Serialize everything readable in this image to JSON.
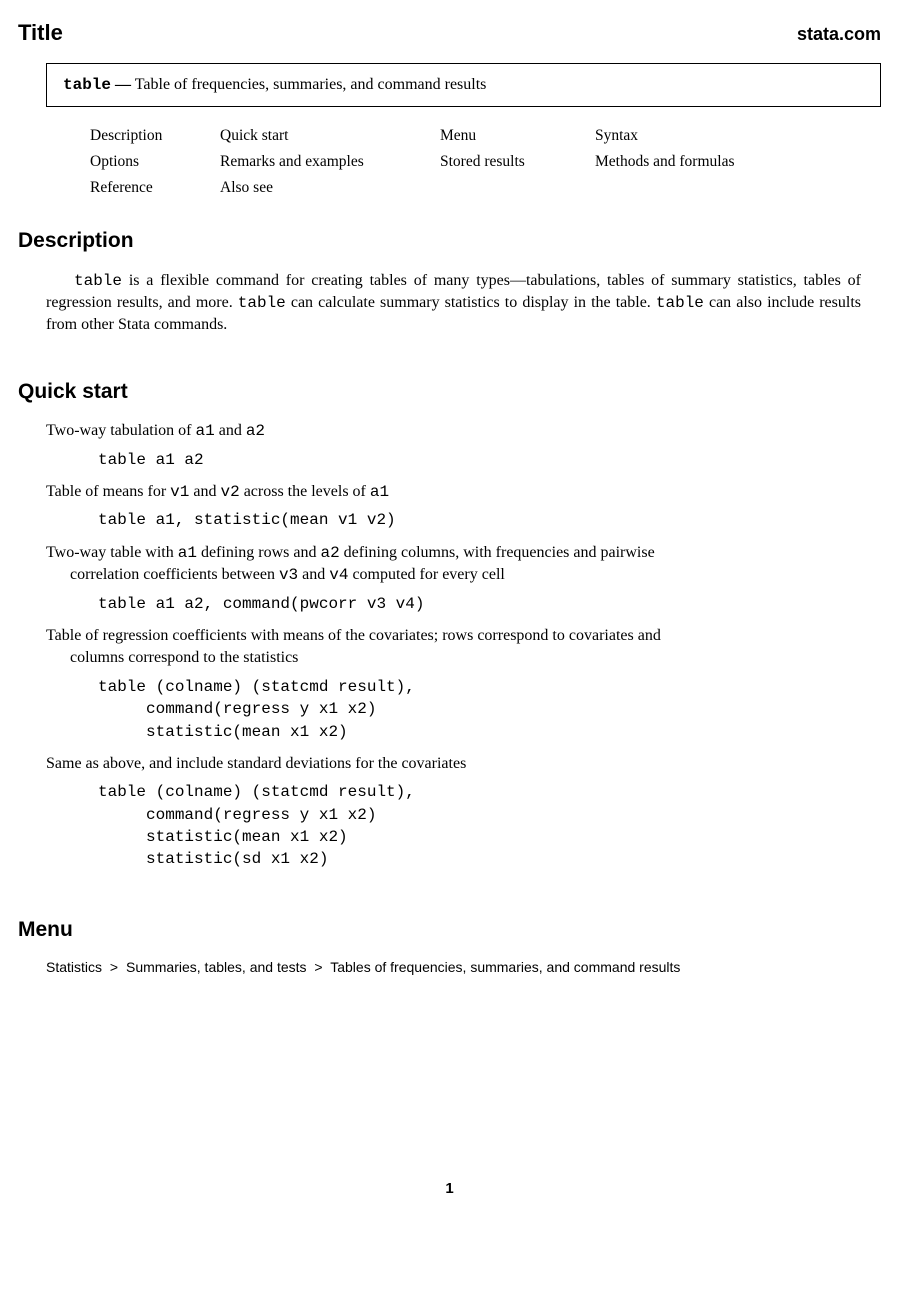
{
  "header": {
    "title": "Title",
    "site": "stata.com"
  },
  "titlebox": {
    "command": "table",
    "dash": "—",
    "text": "Table of frequencies, summaries, and command results"
  },
  "nav": {
    "r1c1": "Description",
    "r1c2": "Quick start",
    "r1c3": "Menu",
    "r1c4": "Syntax",
    "r2c1": "Options",
    "r2c2": "Remarks and examples",
    "r2c3": "Stored results",
    "r2c4": "Methods and formulas",
    "r3c1": "Reference",
    "r3c2": "Also see"
  },
  "sections": {
    "description_h": "Description",
    "quickstart_h": "Quick start",
    "menu_h": "Menu"
  },
  "description": {
    "p1_a": "table",
    "p1_b": " is a flexible command for creating tables of many types—tabulations, tables of summary statistics, tables of regression results, and more. ",
    "p1_c": "table",
    "p1_d": " can calculate summary statistics to display in the table. ",
    "p1_e": "table",
    "p1_f": " can also include results from other Stata commands."
  },
  "qs": {
    "i1_t1": "Two-way tabulation of ",
    "i1_a1": "a1",
    "i1_t2": " and ",
    "i1_a2": "a2",
    "i1_code": "table a1 a2",
    "i2_t1": "Table of means for ",
    "i2_v1": "v1",
    "i2_t2": " and ",
    "i2_v2": "v2",
    "i2_t3": " across the levels of ",
    "i2_a1": "a1",
    "i2_code": "table a1, statistic(mean v1 v2)",
    "i3_t1": "Two-way table with ",
    "i3_a1": "a1",
    "i3_t2": " defining rows and ",
    "i3_a2": "a2",
    "i3_t3": " defining columns, with frequencies and pairwise",
    "i3_cont_t1": "correlation coefficients between ",
    "i3_v3": "v3",
    "i3_cont_t2": " and ",
    "i3_v4": "v4",
    "i3_cont_t3": " computed for every cell",
    "i3_code": "table a1 a2, command(pwcorr v3 v4)",
    "i4_t1": "Table of regression coefficients with means of the covariates; rows correspond to covariates and",
    "i4_cont": "columns correspond to the statistics",
    "i4_code": "table (colname) (statcmd result),\n     command(regress y x1 x2)\n     statistic(mean x1 x2)",
    "i5_t1": "Same as above, and include standard deviations for the covariates",
    "i5_code": "table (colname) (statcmd result),\n     command(regress y x1 x2)\n     statistic(mean x1 x2)\n     statistic(sd x1 x2)"
  },
  "menu": {
    "p1": "Statistics",
    "gt": ">",
    "p2": "Summaries, tables, and tests",
    "p3": "Tables of frequencies, summaries, and command results"
  },
  "page": "1"
}
